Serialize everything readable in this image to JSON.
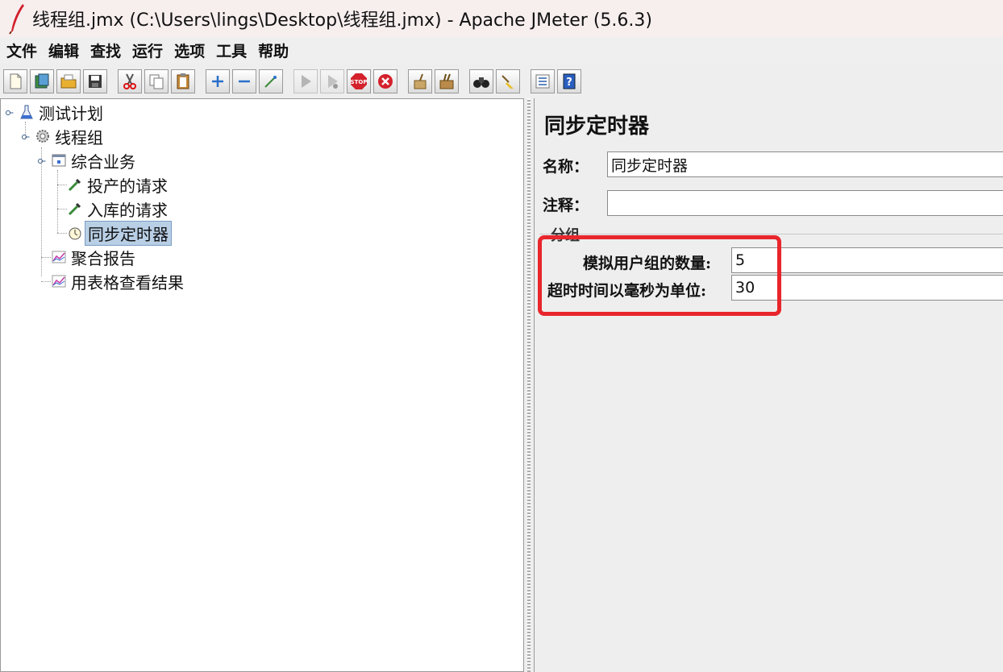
{
  "window": {
    "title": "线程组.jmx (C:\\Users\\lings\\Desktop\\线程组.jmx) - Apache JMeter (5.6.3)"
  },
  "menu": [
    "文件",
    "编辑",
    "查找",
    "运行",
    "选项",
    "工具",
    "帮助"
  ],
  "tree": {
    "root": "测试计划",
    "thread_group": "线程组",
    "transaction": "综合业务",
    "sampler1": "投产的请求",
    "sampler2": "入库的请求",
    "timer": "同步定时器",
    "listener1": "聚合报告",
    "listener2": "用表格查看结果"
  },
  "detail": {
    "title": "同步定时器",
    "name_label": "名称：",
    "name_value": "同步定时器",
    "comment_label": "注释：",
    "comment_value": "",
    "group_legend": "分组",
    "users_label": "模拟用户组的数量:",
    "users_value": "5",
    "timeout_label": "超时时间以毫秒为单位:",
    "timeout_value": "30"
  },
  "colors": {
    "highlight": "#e8262c",
    "selection": "#b8cfe5"
  }
}
